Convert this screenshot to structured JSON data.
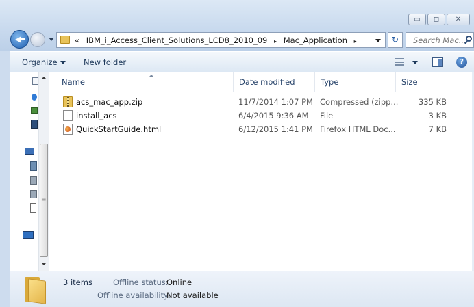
{
  "window": {
    "minimize_glyph": "▭",
    "maximize_glyph": "◻",
    "close_glyph": "✕"
  },
  "address": {
    "prefix": "«",
    "crumbs": [
      "IBM_i_Access_Client_Solutions_LCD8_2010_09",
      "Mac_Application"
    ],
    "separator": "▸"
  },
  "refresh_glyph": "↻",
  "search": {
    "placeholder": "Search Mac..."
  },
  "toolbar": {
    "organize": "Organize",
    "new_folder": "New folder",
    "help": "?"
  },
  "columns": {
    "name": "Name",
    "date": "Date modified",
    "type": "Type",
    "size": "Size"
  },
  "files": [
    {
      "icon": "zip-folder-icon",
      "name": "acs_mac_app.zip",
      "date": "11/7/2014 1:07 PM",
      "type": "Compressed (zipp...",
      "size": "335 KB"
    },
    {
      "icon": "file-icon",
      "name": "install_acs",
      "date": "6/4/2015 9:36 AM",
      "type": "File",
      "size": "3 KB"
    },
    {
      "icon": "firefox-html-icon",
      "name": "QuickStartGuide.html",
      "date": "6/12/2015 1:41 PM",
      "type": "Firefox HTML Doc...",
      "size": "7 KB"
    }
  ],
  "details": {
    "item_count": "3 items",
    "offline_status_label": "Offline status:",
    "offline_status_value": "Online",
    "offline_availability_label": "Offline availability:",
    "offline_availability_value": "Not available"
  },
  "colors": {
    "accent": "#1f5fb0",
    "toolbar_text": "#1e395b",
    "folder": "#e8c35a"
  }
}
